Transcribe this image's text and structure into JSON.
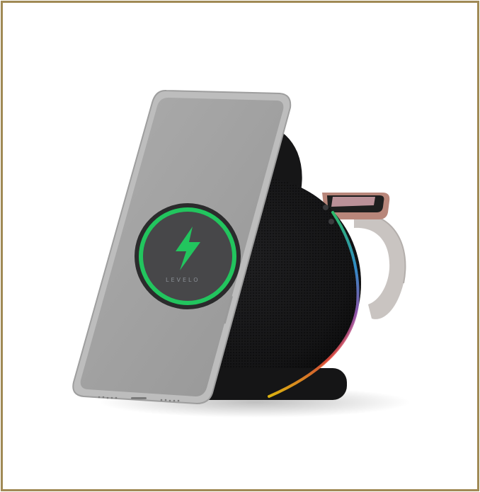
{
  "product": {
    "brand_mark": "LEVELO",
    "icons": [
      "lightning-bolt-icon"
    ]
  },
  "colors": {
    "frame": "#a08a55",
    "charging_ring": "#22c55e",
    "fabric": "#1c1c1e",
    "phone_body": "#bdbdbd"
  }
}
